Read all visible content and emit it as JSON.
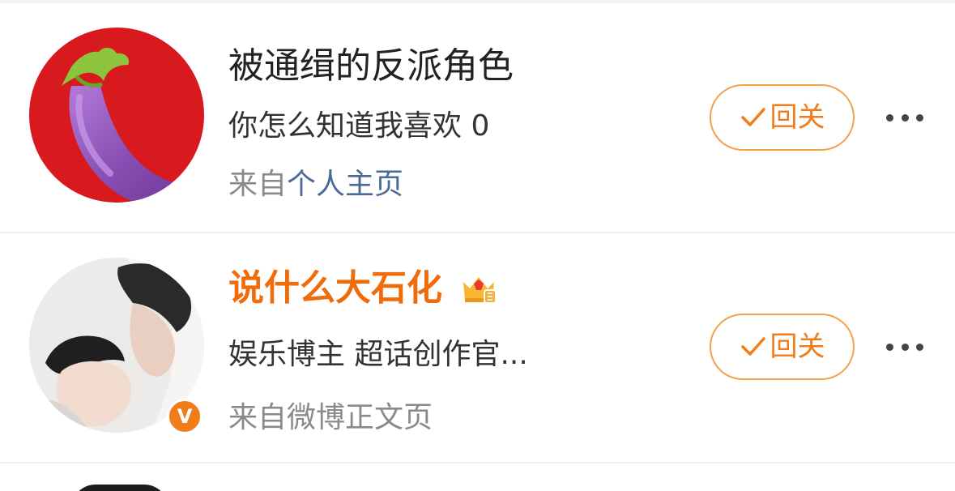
{
  "rows": [
    {
      "name": "被通缉的反派角色",
      "description": "你怎么知道我喜欢 0",
      "source_prefix": "来自",
      "source_link": "个人主页",
      "follow_label": "回关",
      "avatar_icon": "eggplant-icon"
    },
    {
      "name": "说什么大石化",
      "description": "娱乐博主 超话创作官...",
      "source_prefix": "来自微博正文页",
      "follow_label": "回关",
      "avatar_icon": "person-photo",
      "verified_badge": "V",
      "level_icon": "crown-icon"
    }
  ],
  "colors": {
    "accent": "#f07c1a",
    "button_border": "#f5a04c",
    "link": "#4a6a97",
    "muted": "#8a8a8a",
    "eggplant_bg": "#d81a1e"
  }
}
